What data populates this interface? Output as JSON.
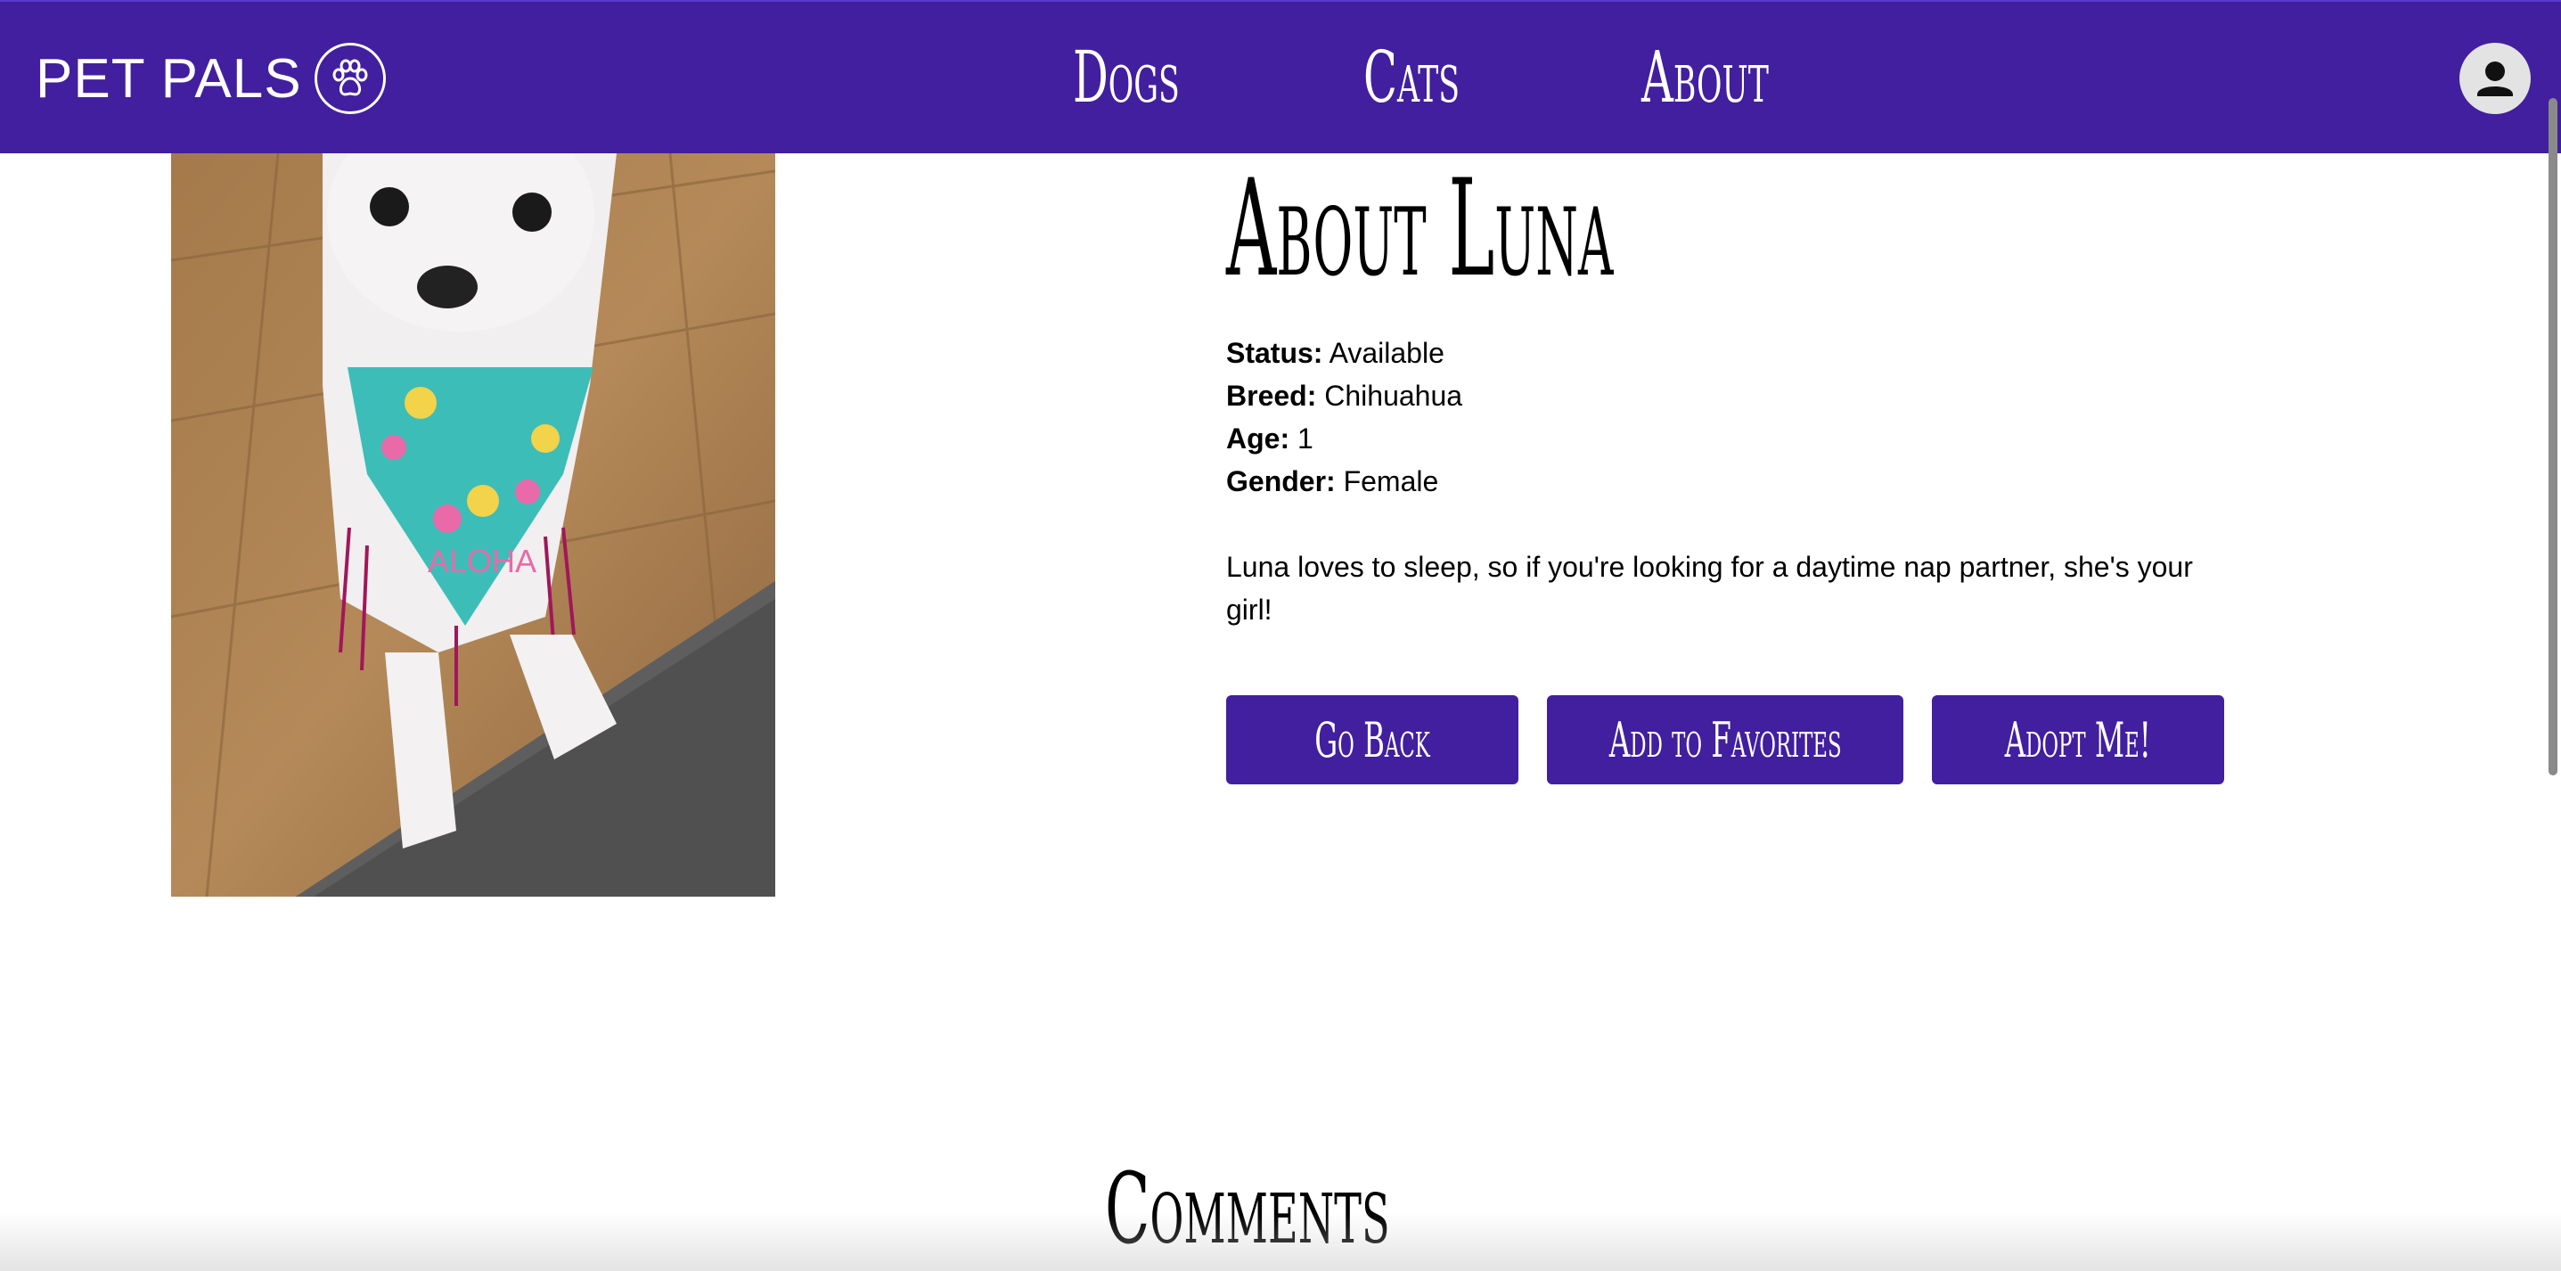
{
  "header": {
    "brand": "PET PALS",
    "nav": [
      "Dogs",
      "Cats",
      "About"
    ]
  },
  "pet": {
    "title": "About Luna",
    "status_label": "Status:",
    "status": "Available",
    "breed_label": "Breed:",
    "breed": "Chihuahua",
    "age_label": "Age:",
    "age": "1",
    "gender_label": "Gender:",
    "gender": "Female",
    "description": "Luna loves to sleep, so if you're looking for a daytime nap partner, she's your girl!",
    "photo_text": "ALOHA"
  },
  "buttons": {
    "back": "Go Back",
    "favorite": "Add to Favorites",
    "adopt": "Adopt Me!"
  },
  "comments": {
    "title": "Comments"
  },
  "colors": {
    "primary": "#411f9e",
    "white": "#ffffff"
  }
}
